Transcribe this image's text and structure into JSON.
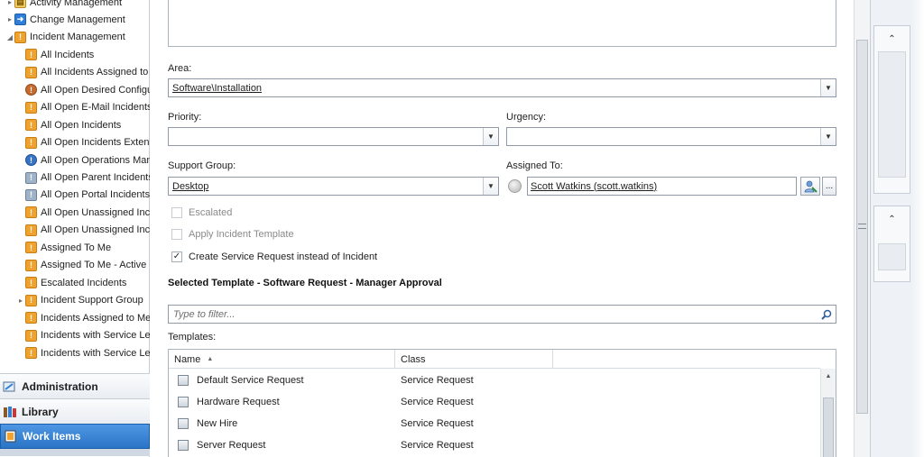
{
  "nav": {
    "tree": [
      {
        "label": "Activity Management",
        "icon": "activity-folder-icon",
        "arrow": "▸",
        "level": 0
      },
      {
        "label": "Change Management",
        "icon": "change-folder-icon",
        "arrow": "▸",
        "level": 0
      },
      {
        "label": "Incident Management",
        "icon": "incident-folder-icon",
        "arrow": "◢",
        "level": 0
      },
      {
        "label": "All Incidents",
        "icon": "incident-view-icon",
        "arrow": "",
        "level": 1
      },
      {
        "label": "All Incidents Assigned to",
        "icon": "incident-view-icon",
        "arrow": "",
        "level": 1
      },
      {
        "label": "All Open Desired Configu",
        "icon": "config-incident-icon",
        "arrow": "",
        "level": 1
      },
      {
        "label": "All Open E-Mail Incidents",
        "icon": "email-incident-icon",
        "arrow": "",
        "level": 1
      },
      {
        "label": "All Open Incidents",
        "icon": "incident-view-icon",
        "arrow": "",
        "level": 1
      },
      {
        "label": "All Open Incidents Extend",
        "icon": "incident-view-icon",
        "arrow": "",
        "level": 1
      },
      {
        "label": "All Open Operations Man",
        "icon": "operations-incident-icon",
        "arrow": "",
        "level": 1
      },
      {
        "label": "All Open Parent Incidents",
        "icon": "parent-incident-icon",
        "arrow": "",
        "level": 1
      },
      {
        "label": "All Open Portal Incidents",
        "icon": "portal-incident-icon",
        "arrow": "",
        "level": 1
      },
      {
        "label": "All Open Unassigned Inc",
        "icon": "incident-view-icon",
        "arrow": "",
        "level": 1
      },
      {
        "label": "All Open Unassigned Inci",
        "icon": "incident-view-icon",
        "arrow": "",
        "level": 1
      },
      {
        "label": "Assigned To Me",
        "icon": "incident-view-icon",
        "arrow": "",
        "level": 1
      },
      {
        "label": "Assigned To Me - Active",
        "icon": "incident-view-icon",
        "arrow": "",
        "level": 1
      },
      {
        "label": "Escalated Incidents",
        "icon": "escalated-incident-icon",
        "arrow": "",
        "level": 1
      },
      {
        "label": "Incident Support Group",
        "icon": "incident-view-icon",
        "arrow": "▸",
        "level": 1
      },
      {
        "label": "Incidents Assigned to Me",
        "icon": "incident-view-icon",
        "arrow": "",
        "level": 1
      },
      {
        "label": "Incidents with Service Lev",
        "icon": "sla-warning-incident-icon",
        "arrow": "",
        "level": 1
      },
      {
        "label": "Incidents with Service Lev",
        "icon": "sla-incident-icon",
        "arrow": "",
        "level": 1
      }
    ],
    "workspaces": [
      {
        "label": "Administration",
        "icon": "administration-icon",
        "active": false
      },
      {
        "label": "Library",
        "icon": "library-icon",
        "active": false
      },
      {
        "label": "Work Items",
        "icon": "work-items-icon",
        "active": true
      }
    ]
  },
  "form": {
    "area_label": "Area:",
    "area_value": "Software\\Installation",
    "priority_label": "Priority:",
    "priority_value": "",
    "urgency_label": "Urgency:",
    "urgency_value": "",
    "support_group_label": "Support Group:",
    "support_group_value": "Desktop",
    "assigned_to_label": "Assigned To:",
    "assigned_to_value": "Scott Watkins (scott.watkins)",
    "browse_label": "...",
    "escalated_label": "Escalated",
    "escalated_checked": false,
    "apply_template_label": "Apply Incident Template",
    "apply_template_checked": false,
    "create_sr_label": "Create Service Request instead of Incident",
    "create_sr_checked": true,
    "selected_template_title": "Selected Template - Software Request - Manager Approval",
    "filter_placeholder": "Type to filter...",
    "templates_label": "Templates:",
    "columns": [
      "Name",
      "Class"
    ],
    "sort_indicator": "▲",
    "templates": [
      {
        "name": "Default Service Request",
        "class": "Service Request"
      },
      {
        "name": "Hardware Request",
        "class": "Service Request"
      },
      {
        "name": "New Hire",
        "class": "Service Request"
      },
      {
        "name": "Server Request",
        "class": "Service Request"
      }
    ]
  },
  "taskpane": {
    "collapse_glyph": "⌃"
  }
}
